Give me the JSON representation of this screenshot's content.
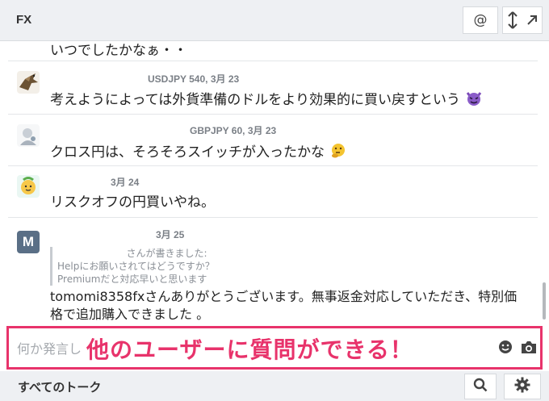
{
  "header": {
    "title": "FX",
    "mention_label": "@"
  },
  "messages": [
    {
      "text": "いつでしたかなぁ・・"
    },
    {
      "meta": "USDJPY 540, 3月 23",
      "text": "考えようによっては外貨準備のドルをより効果的に買い戻すという",
      "emoji": "devil-emoji"
    },
    {
      "meta": "GBPJPY 60, 3月 23",
      "text": "クロス円は、そろそろスイッチが入ったかな",
      "emoji": "thinking-emoji"
    },
    {
      "meta": "3月 24",
      "text": "リスクオフの円買いやね。"
    },
    {
      "meta": "3月 25",
      "avatar_letter": "M",
      "quote": {
        "header": "さんが書きました:",
        "line1": "Helpにお願いされてはどうですか？",
        "line2": "Premiumだと対応早いと思います"
      },
      "text_line1": "tomomi8358fxさんありがとうございます。無事返金対応していただき、特別価",
      "text_line2": "格で追加購入できました 。"
    }
  ],
  "composer": {
    "placeholder": "何か発言し",
    "annotation": "他のユーザーに質問ができる！",
    "highlight_color": "#e8336b"
  },
  "footer": {
    "title": "すべてのトーク"
  }
}
